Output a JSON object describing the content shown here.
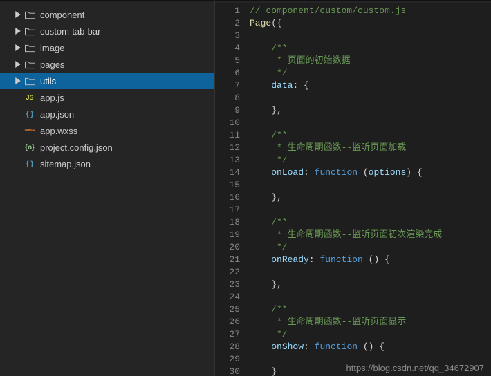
{
  "sidebar": {
    "folders": [
      {
        "label": "component"
      },
      {
        "label": "custom-tab-bar"
      },
      {
        "label": "image"
      },
      {
        "label": "pages"
      },
      {
        "label": "utils",
        "selected": true
      }
    ],
    "files": [
      {
        "icon": "js",
        "label": "app.js"
      },
      {
        "icon": "json",
        "label": "app.json"
      },
      {
        "icon": "wxss",
        "label": "app.wxss"
      },
      {
        "icon": "config",
        "label": "project.config.json"
      },
      {
        "icon": "json",
        "label": "sitemap.json"
      }
    ]
  },
  "code": {
    "lines": [
      {
        "n": 1,
        "seg": [
          {
            "c": "tok-comment",
            "t": "// component/custom/custom.js"
          }
        ]
      },
      {
        "n": 2,
        "seg": [
          {
            "c": "tok-fn",
            "t": "Page"
          },
          {
            "c": "tok-pun",
            "t": "({"
          }
        ]
      },
      {
        "n": 3,
        "seg": []
      },
      {
        "n": 4,
        "seg": [
          {
            "c": "tok-comment",
            "t": "    /**"
          }
        ]
      },
      {
        "n": 5,
        "seg": [
          {
            "c": "tok-comment",
            "t": "     * 页面的初始数据"
          }
        ]
      },
      {
        "n": 6,
        "seg": [
          {
            "c": "tok-comment",
            "t": "     */"
          }
        ]
      },
      {
        "n": 7,
        "seg": [
          {
            "c": "tok-pun",
            "t": "    "
          },
          {
            "c": "tok-prop",
            "t": "data"
          },
          {
            "c": "tok-pun",
            "t": ": {"
          }
        ]
      },
      {
        "n": 8,
        "seg": []
      },
      {
        "n": 9,
        "seg": [
          {
            "c": "tok-pun",
            "t": "    },"
          }
        ]
      },
      {
        "n": 10,
        "seg": []
      },
      {
        "n": 11,
        "seg": [
          {
            "c": "tok-comment",
            "t": "    /**"
          }
        ]
      },
      {
        "n": 12,
        "seg": [
          {
            "c": "tok-comment",
            "t": "     * 生命周期函数--监听页面加载"
          }
        ]
      },
      {
        "n": 13,
        "seg": [
          {
            "c": "tok-comment",
            "t": "     */"
          }
        ]
      },
      {
        "n": 14,
        "seg": [
          {
            "c": "tok-pun",
            "t": "    "
          },
          {
            "c": "tok-prop",
            "t": "onLoad"
          },
          {
            "c": "tok-pun",
            "t": ": "
          },
          {
            "c": "tok-kw",
            "t": "function"
          },
          {
            "c": "tok-pun",
            "t": " ("
          },
          {
            "c": "tok-param",
            "t": "options"
          },
          {
            "c": "tok-pun",
            "t": ") {"
          }
        ]
      },
      {
        "n": 15,
        "seg": []
      },
      {
        "n": 16,
        "seg": [
          {
            "c": "tok-pun",
            "t": "    },"
          }
        ]
      },
      {
        "n": 17,
        "seg": []
      },
      {
        "n": 18,
        "seg": [
          {
            "c": "tok-comment",
            "t": "    /**"
          }
        ]
      },
      {
        "n": 19,
        "seg": [
          {
            "c": "tok-comment",
            "t": "     * 生命周期函数--监听页面初次渲染完成"
          }
        ]
      },
      {
        "n": 20,
        "seg": [
          {
            "c": "tok-comment",
            "t": "     */"
          }
        ]
      },
      {
        "n": 21,
        "seg": [
          {
            "c": "tok-pun",
            "t": "    "
          },
          {
            "c": "tok-prop",
            "t": "onReady"
          },
          {
            "c": "tok-pun",
            "t": ": "
          },
          {
            "c": "tok-kw",
            "t": "function"
          },
          {
            "c": "tok-pun",
            "t": " () {"
          }
        ]
      },
      {
        "n": 22,
        "seg": []
      },
      {
        "n": 23,
        "seg": [
          {
            "c": "tok-pun",
            "t": "    },"
          }
        ]
      },
      {
        "n": 24,
        "seg": []
      },
      {
        "n": 25,
        "seg": [
          {
            "c": "tok-comment",
            "t": "    /**"
          }
        ]
      },
      {
        "n": 26,
        "seg": [
          {
            "c": "tok-comment",
            "t": "     * 生命周期函数--监听页面显示"
          }
        ]
      },
      {
        "n": 27,
        "seg": [
          {
            "c": "tok-comment",
            "t": "     */"
          }
        ]
      },
      {
        "n": 28,
        "seg": [
          {
            "c": "tok-pun",
            "t": "    "
          },
          {
            "c": "tok-prop",
            "t": "onShow"
          },
          {
            "c": "tok-pun",
            "t": ": "
          },
          {
            "c": "tok-kw",
            "t": "function"
          },
          {
            "c": "tok-pun",
            "t": " () {"
          }
        ]
      },
      {
        "n": 29,
        "seg": []
      },
      {
        "n": 30,
        "seg": [
          {
            "c": "tok-pun",
            "t": "    }"
          }
        ]
      }
    ]
  },
  "watermark": "https://blog.csdn.net/qq_34672907",
  "icons": {
    "js": "JS",
    "json": "{ }",
    "wxss": "wxss",
    "config": "{o}"
  }
}
